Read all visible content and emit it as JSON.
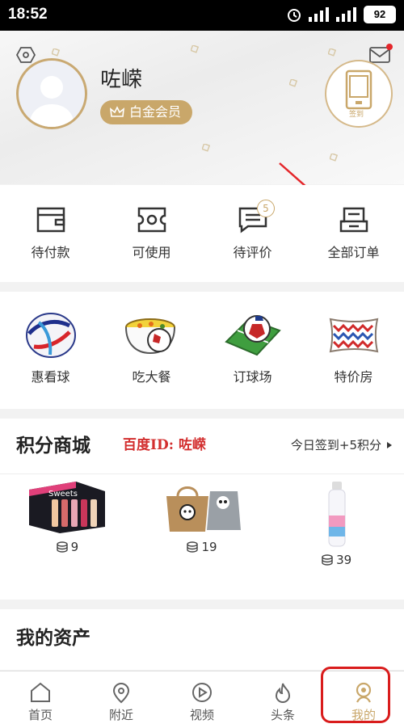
{
  "status_bar": {
    "time": "18:52",
    "battery": "92"
  },
  "profile": {
    "username": "咗嵘",
    "vip_label": "白金会员",
    "checkin_label": "签到"
  },
  "orders": [
    {
      "label": "待付款",
      "icon": "wallet-icon"
    },
    {
      "label": "可使用",
      "icon": "ticket-icon"
    },
    {
      "label": "待评价",
      "icon": "comment-icon",
      "badge": "5"
    },
    {
      "label": "全部订单",
      "icon": "order-list-icon"
    }
  ],
  "services": [
    {
      "label": "惠看球",
      "icon": "football-icon"
    },
    {
      "label": "吃大餐",
      "icon": "soup-bowl-icon"
    },
    {
      "label": "订球场",
      "icon": "pitch-icon"
    },
    {
      "label": "特价房",
      "icon": "pillow-icon"
    }
  ],
  "mall": {
    "title": "积分商城",
    "watermark": "百度ID: 咗嵘",
    "checkin_link": "今日签到+5积分",
    "products": [
      {
        "points": "9",
        "image": "nail-polish-set",
        "brand_text": "Sweets"
      },
      {
        "points": "19",
        "image": "tote-bags"
      },
      {
        "points": "39",
        "image": "spray-bottle"
      }
    ]
  },
  "assets": {
    "title": "我的资产"
  },
  "tabbar": [
    {
      "label": "首页",
      "icon": "home-icon"
    },
    {
      "label": "附近",
      "icon": "location-icon"
    },
    {
      "label": "视频",
      "icon": "play-icon"
    },
    {
      "label": "头条",
      "icon": "flame-icon"
    },
    {
      "label": "我的",
      "icon": "user-icon",
      "active": true
    }
  ],
  "colors": {
    "gold": "#c9a76a",
    "annotation_red": "#d91c1c",
    "badge_red": "#e4262a"
  }
}
